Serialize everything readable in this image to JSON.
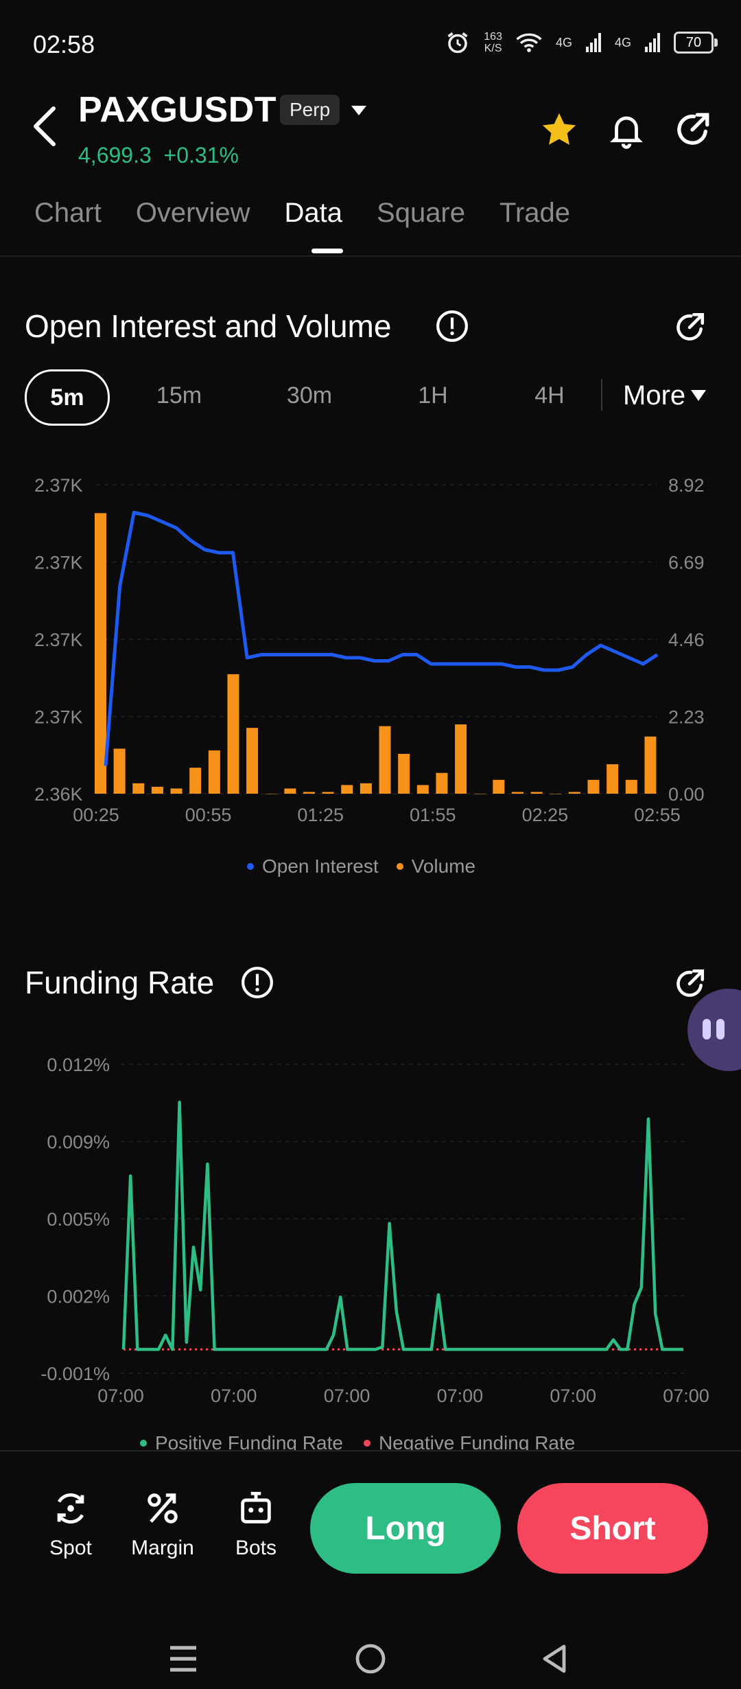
{
  "status": {
    "time": "02:58",
    "net_speed_top": "163",
    "net_speed_bottom": "K/S",
    "sig1": "4G",
    "sig2": "4G",
    "battery": "70"
  },
  "header": {
    "symbol": "PAXGUSDT",
    "badge": "Perp",
    "price": "4,699.3",
    "change": "+0.31%"
  },
  "tabs": [
    "Chart",
    "Overview",
    "Data",
    "Square",
    "Trade"
  ],
  "active_tab": "Data",
  "oi_section": {
    "title": "Open Interest and Volume",
    "intervals": [
      "5m",
      "15m",
      "30m",
      "1H",
      "4H"
    ],
    "active_interval": "5m",
    "more_label": "More",
    "legend": [
      "Open Interest",
      "Volume"
    ],
    "colors": {
      "oi": "#1f5af0",
      "volume": "#f7931a"
    }
  },
  "funding_section": {
    "title": "Funding Rate",
    "legend": [
      "Positive Funding Rate",
      "Negative Funding Rate"
    ],
    "colors": {
      "positive": "#2ebd85",
      "negative": "#f6465d"
    }
  },
  "chart_data": [
    {
      "type": "bar+line",
      "x_tick_labels": [
        "00:25",
        "00:55",
        "01:25",
        "01:55",
        "02:25",
        "02:55"
      ],
      "y_left_ticks": [
        "2.37K",
        "2.37K",
        "2.37K",
        "2.37K",
        "2.36K"
      ],
      "y_right_ticks": [
        "8.92",
        "6.69",
        "4.46",
        "2.23",
        "0.00"
      ],
      "y_right_range": [
        0,
        8.92
      ],
      "series": [
        {
          "name": "Volume",
          "type": "bar",
          "values": [
            8.1,
            1.3,
            0.3,
            0.2,
            0.15,
            0.75,
            1.25,
            3.45,
            1.9,
            0,
            0.15,
            0.05,
            0.05,
            0.25,
            0.3,
            1.95,
            1.15,
            0.25,
            0.6,
            2.0,
            0,
            0.4,
            0.05,
            0.05,
            0,
            0.05,
            0.4,
            0.85,
            0.4,
            1.65
          ]
        },
        {
          "name": "Open Interest",
          "type": "line",
          "values_normalized_0_1": [
            0.09,
            0.67,
            0.91,
            0.9,
            0.88,
            0.86,
            0.82,
            0.79,
            0.78,
            0.78,
            0.44,
            0.45,
            0.45,
            0.45,
            0.45,
            0.45,
            0.45,
            0.44,
            0.44,
            0.43,
            0.43,
            0.45,
            0.45,
            0.42,
            0.42,
            0.42,
            0.42,
            0.42,
            0.42,
            0.41,
            0.41,
            0.4,
            0.4,
            0.41,
            0.45,
            0.48,
            0.46,
            0.44,
            0.42,
            0.45
          ]
        }
      ]
    },
    {
      "type": "line",
      "x_tick_labels": [
        "07:00",
        "07:00",
        "07:00",
        "07:00",
        "07:00",
        "07:00"
      ],
      "y_ticks": [
        "0.012%",
        "0.009%",
        "0.005%",
        "0.002%",
        "-0.001%"
      ],
      "ylim": [
        -0.001,
        0.012
      ],
      "series": [
        {
          "name": "Positive Funding Rate",
          "values": [
            0,
            0.0073,
            0,
            0,
            0,
            0,
            0.0006,
            0,
            0.0104,
            0.0003,
            0.0043,
            0.0025,
            0.0078,
            0,
            0,
            0,
            0,
            0,
            0,
            0,
            0,
            0,
            0,
            0,
            0,
            0,
            0,
            0,
            0,
            0,
            0.0006,
            0.0022,
            0,
            0,
            0,
            0,
            0,
            0.0001,
            0.0053,
            0.0016,
            0,
            0,
            0,
            0,
            0,
            0.0023,
            0,
            0,
            0,
            0,
            0,
            0,
            0,
            0,
            0,
            0,
            0,
            0,
            0,
            0,
            0,
            0,
            0,
            0,
            0,
            0,
            0,
            0,
            0,
            0,
            0.0004,
            0,
            0,
            0.0019,
            0.0026,
            0.0097,
            0.0015,
            0,
            0,
            0,
            0
          ]
        },
        {
          "name": "Negative Funding Rate",
          "values": []
        }
      ]
    }
  ],
  "bottom_bar": {
    "spot": "Spot",
    "margin": "Margin",
    "bots": "Bots",
    "long": "Long",
    "short": "Short"
  }
}
